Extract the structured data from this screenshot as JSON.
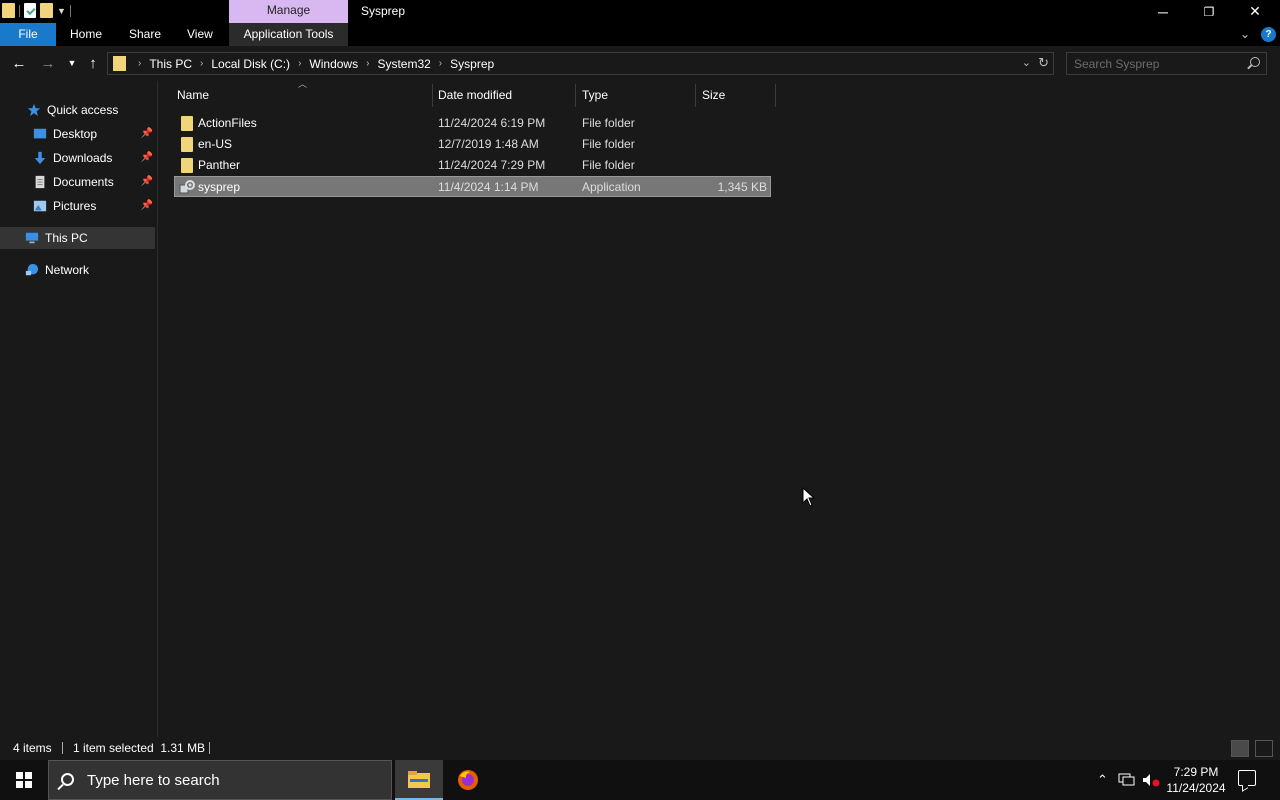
{
  "window": {
    "title": "Sysprep",
    "context_tab": "Manage",
    "controls": {
      "minimize": "─",
      "restore": "❐",
      "close": "✕"
    }
  },
  "ribbon": {
    "tabs": [
      "File",
      "Home",
      "Share",
      "View",
      "Application Tools"
    ]
  },
  "address": {
    "breadcrumbs": [
      "This PC",
      "Local Disk (C:)",
      "Windows",
      "System32",
      "Sysprep"
    ]
  },
  "search": {
    "placeholder": "Search Sysprep"
  },
  "nav": {
    "quick_access": "Quick access",
    "items": [
      {
        "label": "Desktop",
        "icon": "desktop-icon",
        "pinned": true
      },
      {
        "label": "Downloads",
        "icon": "downloads-icon",
        "pinned": true
      },
      {
        "label": "Documents",
        "icon": "documents-icon",
        "pinned": true
      },
      {
        "label": "Pictures",
        "icon": "pictures-icon",
        "pinned": true
      }
    ],
    "this_pc": "This PC",
    "network": "Network"
  },
  "columns": [
    "Name",
    "Date modified",
    "Type",
    "Size"
  ],
  "files": [
    {
      "name": "ActionFiles",
      "date": "11/24/2024 6:19 PM",
      "type": "File folder",
      "size": "",
      "icon": "folder-icon",
      "selected": false
    },
    {
      "name": "en-US",
      "date": "12/7/2019 1:48 AM",
      "type": "File folder",
      "size": "",
      "icon": "folder-icon",
      "selected": false
    },
    {
      "name": "Panther",
      "date": "11/24/2024 7:29 PM",
      "type": "File folder",
      "size": "",
      "icon": "folder-icon",
      "selected": false
    },
    {
      "name": "sysprep",
      "date": "11/4/2024 1:14 PM",
      "type": "Application",
      "size": "1,345 KB",
      "icon": "application-icon",
      "selected": true
    }
  ],
  "status": {
    "count": "4 items",
    "selection": "1 item selected  1.31 MB"
  },
  "taskbar": {
    "search_placeholder": "Type here to search",
    "time": "7:29 PM",
    "date": "11/24/2024"
  },
  "colors": {
    "accent": "#1979ca",
    "manage_tab": "#d9b8f2",
    "folder": "#f2d57a",
    "background": "#191919"
  }
}
